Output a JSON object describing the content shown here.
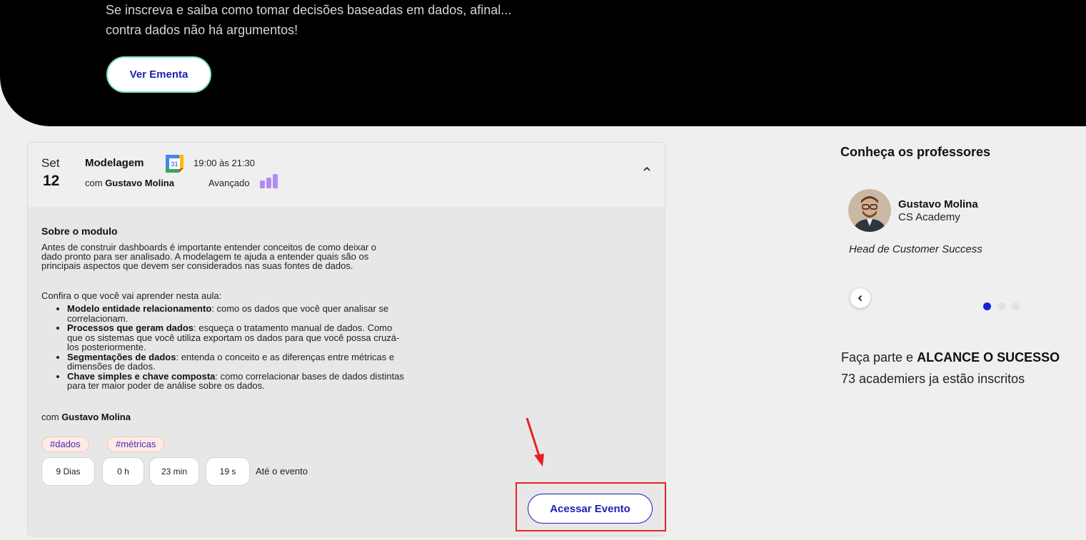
{
  "hero": {
    "line1": "Se inscreva e saiba como tomar decisões baseadas em dados, afinal...",
    "line2": "contra dados não há argumentos!",
    "button_label": "Ver Ementa"
  },
  "module": {
    "month": "Set",
    "day": "12",
    "title": "Modelagem",
    "calendar_icon_number": "31",
    "time": "19:00 às 21:30",
    "with_prefix": "com",
    "instructor": "Gustavo Molina",
    "level": "Avançado",
    "about_title": "Sobre o modulo",
    "about_text": "Antes de construir dashboards é importante entender conceitos de como deixar o dado pronto para ser analisado. A modelagem te ajuda a entender quais são os principais aspectos que devem ser considerados nas suas fontes de dados.",
    "learn_title": "Confira o que você vai aprender nesta aula:",
    "topics": [
      {
        "title": "Modelo entidade relacionamento",
        "desc": ": como os dados que você quer analisar se correlacionam."
      },
      {
        "title": "Processos que geram dados",
        "desc": ": esqueça o tratamento manual de dados. Como que os sistemas que você utiliza exportam os dados para que você possa cruzá-los posteriormente."
      },
      {
        "title": "Segmentações de dados",
        "desc": ": entenda o conceito e as diferenças entre métricas e dimensões de dados."
      },
      {
        "title": "Chave simples e chave composta",
        "desc": ": como correlacionar bases de dados distintas para ter maior poder de análise sobre os dados."
      }
    ],
    "by_prefix": "com",
    "by_name": "Gustavo Molina",
    "tags": [
      "#dados",
      "#métricas"
    ],
    "countdown": {
      "days": "9 Dias",
      "hours": "0 h",
      "minutes": "23 min",
      "seconds": "19 s",
      "label": "Até o evento"
    },
    "access_button": "Acessar Evento"
  },
  "sidebar": {
    "title": "Conheça os professores",
    "professor": {
      "name": "Gustavo Molina",
      "org": "CS Academy",
      "role": "Head de Customer Success"
    },
    "cta_prefix": "Faça parte e",
    "cta_bold": "ALCANCE O SUCESSO",
    "cta_count": "73 academiers ja estão inscritos"
  },
  "colors": {
    "accent": "#1c1fb8",
    "level_bars": "#b28bf2",
    "annotation": "#e52222"
  }
}
